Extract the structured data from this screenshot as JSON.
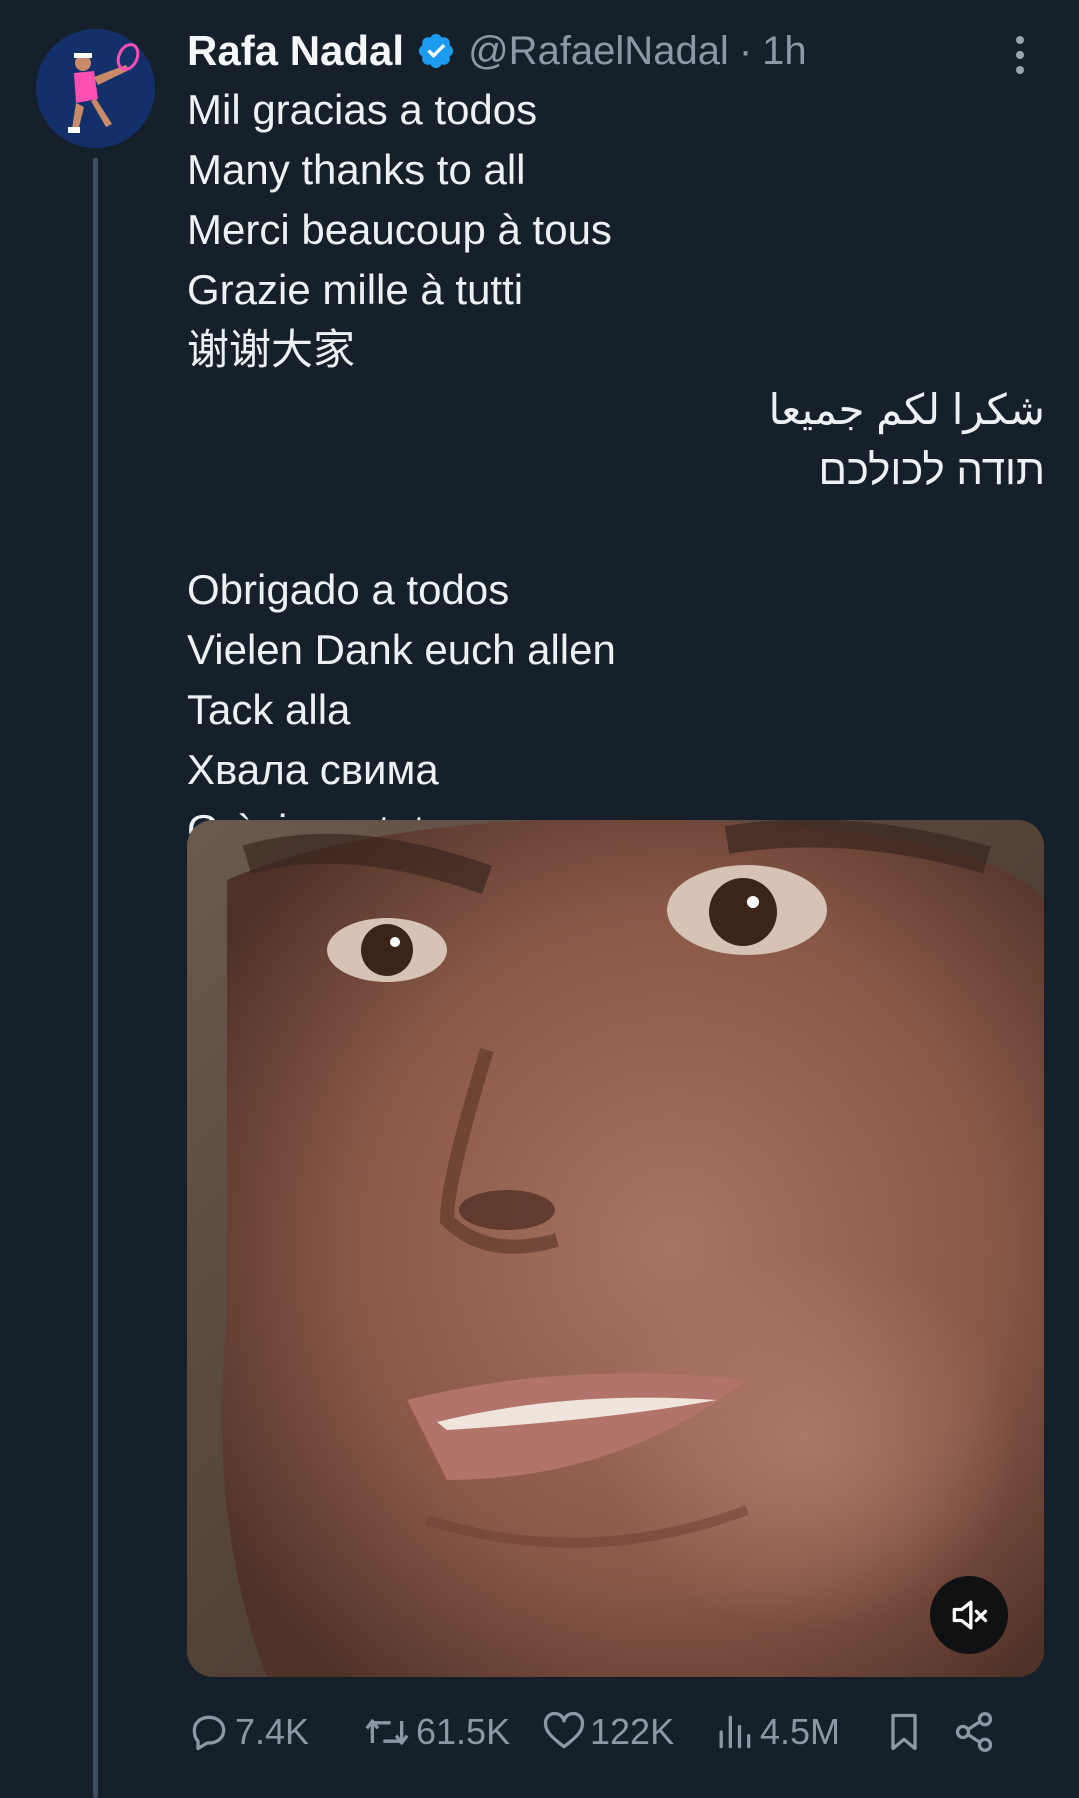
{
  "tweet": {
    "author_name": "Rafa Nadal",
    "handle": "@RafaelNadal",
    "separator": "·",
    "time": "1h",
    "lines": [
      "Mil gracias a todos",
      "Many thanks to all",
      "Merci beaucoup à tous",
      "Grazie mille à tutti",
      "谢谢大家",
      "شكرا لكم جميعا",
      "תודה לכולכם",
      "",
      "Obrigado a todos",
      "Vielen Dank euch allen",
      "Tack alla",
      "Хвала свима",
      "Gràcies a tots"
    ],
    "stats": {
      "replies": "7.4K",
      "reposts": "61.5K",
      "likes": "122K",
      "views": "4.5M"
    }
  },
  "colors": {
    "background": "#16202b",
    "verified": "#1d9bf0",
    "muted_text": "#8b98a5",
    "thread_line": "#3d4e5e"
  },
  "icons": {
    "verified": "verified-badge-icon",
    "more": "more-vertical-icon",
    "reply": "reply-icon",
    "repost": "repost-icon",
    "like": "heart-icon",
    "views": "views-icon",
    "bookmark": "bookmark-icon",
    "share": "share-icon",
    "mute": "volume-muted-icon"
  },
  "media": {
    "muted": true
  }
}
